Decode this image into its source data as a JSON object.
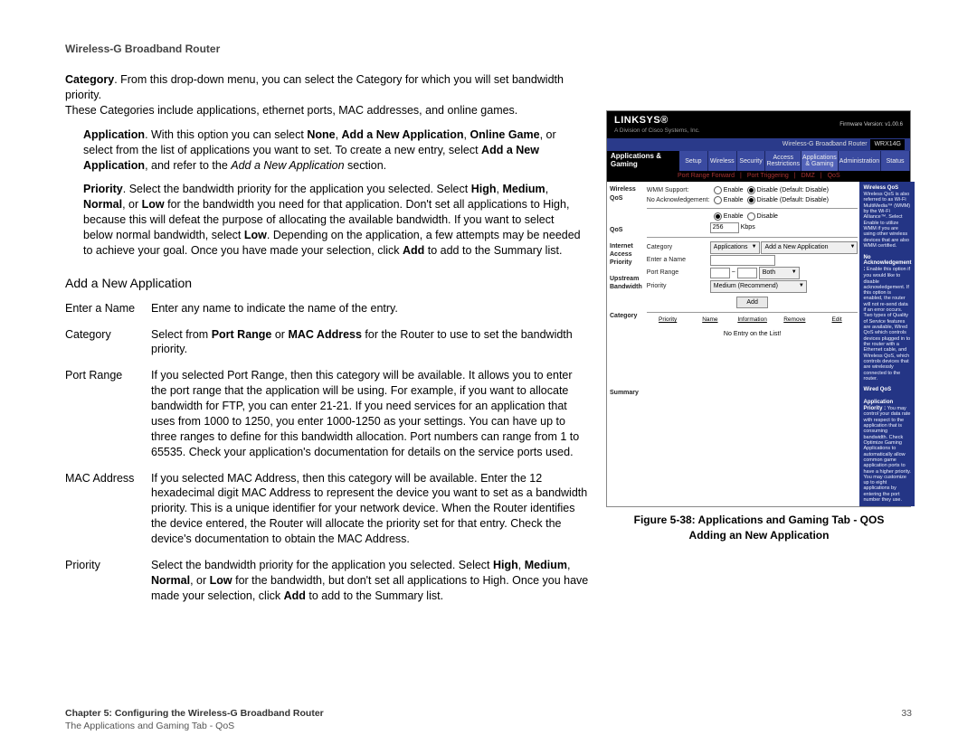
{
  "header": {
    "product": "Wireless-G Broadband Router"
  },
  "intro": {
    "label": "Category",
    "text1": ". From this drop-down menu, you can select the Category for which you will set bandwidth priority.",
    "text2": "These Categories include applications, ethernet ports, MAC addresses, and online games."
  },
  "bullets": {
    "app": {
      "label": "Application",
      "t1": ". With this option you can select ",
      "b1": "None",
      "b2": "Add a New Application",
      "b3": "Online Game",
      "t2": ", or select from the list of applications you want to set. To create a new entry, select ",
      "b4": "Add a New Application",
      "t3": ", and refer to the ",
      "i1": "Add a New Application",
      "t4": " section."
    },
    "pri": {
      "label": "Priority",
      "t1": ". Select the bandwidth priority for the application you selected. Select ",
      "h": "High",
      "m": "Medium",
      "n": "Normal",
      "t2": ", or ",
      "l": "Low",
      "t3": " for the bandwidth you need for that application. Don't set all applications to High, because this will defeat the purpose of allocating the available bandwidth. If you want to select below normal bandwidth, select ",
      "l2": "Low",
      "t4": ". Depending on the application, a few attempts may be needed to achieve your goal. Once you have made your selection, click ",
      "add": "Add",
      "t5": " to add to the Summary list."
    }
  },
  "section_heading": "Add a New Application",
  "defs": {
    "enter_name": {
      "k": "Enter a Name",
      "v": "Enter any name to indicate the name of the entry."
    },
    "category": {
      "k": "Category",
      "t1": "Select from ",
      "b1": "Port Range",
      "or": " or ",
      "b2": "MAC Address",
      "t2": " for the Router to use to set the bandwidth priority."
    },
    "port_range": {
      "k": "Port Range",
      "v": "If you selected Port Range, then this category will be available. It allows you to enter the port range that the application will be using. For example, if you want to allocate bandwidth for FTP, you can enter 21-21. If you need services for an application that uses from 1000 to 1250, you enter 1000-1250 as your settings. You can have up to three ranges to define for this bandwidth allocation. Port numbers can range from 1 to 65535. Check your application's documentation for details on the service ports used."
    },
    "mac": {
      "k": "MAC Address",
      "v": "If you selected MAC Address, then this category will be available. Enter the 12 hexadecimal digit MAC Address to represent the device you want to set as a bandwidth priority. This is a unique identifier for your network device. When the Router identifies the device entered, the Router will allocate the priority set for that entry. Check the device's documentation to obtain the MAC Address."
    },
    "priority": {
      "k": "Priority",
      "t1": "Select the bandwidth priority for the application you selected. Select ",
      "h": "High",
      "m": "Medium",
      "n": "Normal",
      "t2": ", or ",
      "l": "Low",
      "t3": " for the bandwidth, but don't set all applications to High. Once you have made your selection, click ",
      "add": "Add",
      "t4": " to add to the Summary list."
    }
  },
  "figure": {
    "caption1": "Figure 5-38: Applications and Gaming Tab - QOS",
    "caption2": "Adding an New Application"
  },
  "shot": {
    "brand": "LINKSYS®",
    "subbrand": "A Division of Cisco Systems, Inc.",
    "fw": "Firmware Version: v1.00.6",
    "bar_title": "Wireless-G Broadband Router",
    "bar_model": "WRX14G",
    "side_tab": "Applications & Gaming",
    "tabs": [
      "Setup",
      "Wireless",
      "Security",
      "Access Restrictions",
      "Applications & Gaming",
      "Administration",
      "Status"
    ],
    "subtabs": [
      "Port Range Forward",
      "Port Triggering",
      "DMZ",
      "QoS"
    ],
    "left_labels": [
      "Wireless QoS",
      "",
      "QoS",
      "Internet Access Priority",
      "Upstream Bandwidth",
      "",
      "Category",
      "",
      "",
      "",
      "",
      "",
      "Summary"
    ],
    "rows": {
      "wmm": "WMM Support:",
      "noack": "No Acknowledgement:",
      "enable": "Enable",
      "disable": "Disable",
      "default": "(Default: Disable)",
      "iap_on": "Enable",
      "iap_off": "Disable",
      "bw_val": "256",
      "bw_unit": "Kbps",
      "cat_label": "Category",
      "cat_sel": "Applications",
      "app_sel": "Add a New Application",
      "name_label": "Enter a Name",
      "pr_label": "Port Range",
      "pr_sel": "Both",
      "pri_label": "Priority",
      "pri_sel": "Medium (Recommend)",
      "add_btn": "Add",
      "sum_cols": [
        "Priority",
        "Name",
        "Information",
        "Remove",
        "Edit"
      ],
      "noentry": "No Entry on the List!"
    },
    "help": {
      "h1": "Wireless QoS",
      "p1": "Wireless QoS is also referred to as Wi-Fi MultiMedia™ (WMM) by the Wi-Fi Alliance™. Select Enable to utilize WMM if you are using other wireless devices that are also WMM certified.",
      "h2": "No Acknowledgement :",
      "p2": "Enable this option if you would like to disable acknowledgement. If this option is enabled, the router will not re-send data if an error occurs. Two types of Quality of Service features are available, Wired QoS which controls devices plugged in to the router with a Ethernet cable, and Wireless QoS, which controls devices that are wirelessly connected to the router.",
      "h3": "Wired QoS",
      "h4": "Application Priority :",
      "p3": "You may control your data rate with respect to the application that is consuming bandwidth. Check Optimize Gaming Applications to automatically allow common game application ports to have a higher priority. You may customize up to eight applications by entering the port number they use."
    }
  },
  "footer": {
    "line1a": "Chapter 5: Configuring the Wireless-G Broadband Router",
    "line2": "The Applications and Gaming Tab - QoS",
    "page": "33"
  }
}
